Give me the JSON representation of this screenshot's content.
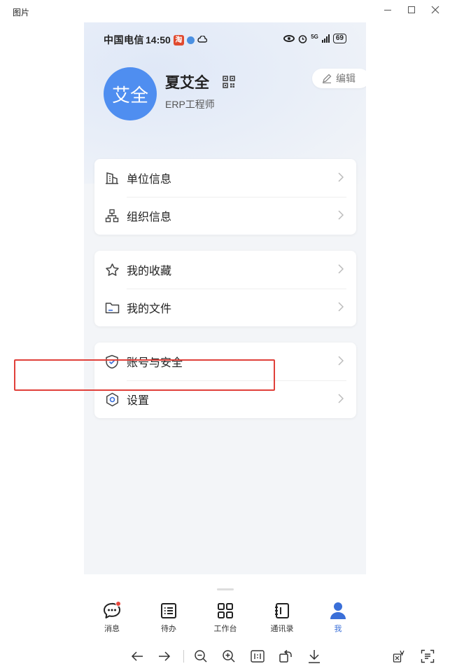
{
  "window": {
    "title": "图片"
  },
  "status_bar": {
    "carrier": "中国电信",
    "time": "14:50",
    "tao": "淘",
    "signal": "5G",
    "battery": "69"
  },
  "profile": {
    "avatar_text": "艾全",
    "name": "夏艾全",
    "role": "ERP工程师",
    "edit_label": "编辑"
  },
  "groups": [
    {
      "items": [
        {
          "label": "单位信息",
          "icon": "building-icon"
        },
        {
          "label": "组织信息",
          "icon": "org-chart-icon"
        }
      ]
    },
    {
      "items": [
        {
          "label": "我的收藏",
          "icon": "star-icon"
        },
        {
          "label": "我的文件",
          "icon": "folder-icon"
        }
      ]
    },
    {
      "items": [
        {
          "label": "账号与安全",
          "icon": "shield-check-icon"
        },
        {
          "label": "设置",
          "icon": "gear-icon"
        }
      ]
    }
  ],
  "nav": [
    {
      "label": "消息",
      "icon": "chat-bubble-icon",
      "badge": true
    },
    {
      "label": "待办",
      "icon": "todo-list-icon"
    },
    {
      "label": "工作台",
      "icon": "apps-grid-icon"
    },
    {
      "label": "通讯录",
      "icon": "contacts-book-icon"
    },
    {
      "label": "我",
      "icon": "person-icon",
      "active": true
    }
  ],
  "colors": {
    "accent": "#3a6fd8",
    "avatar": "#4f8ef0",
    "highlight": "#e0403a",
    "badge": "#e8463c"
  }
}
